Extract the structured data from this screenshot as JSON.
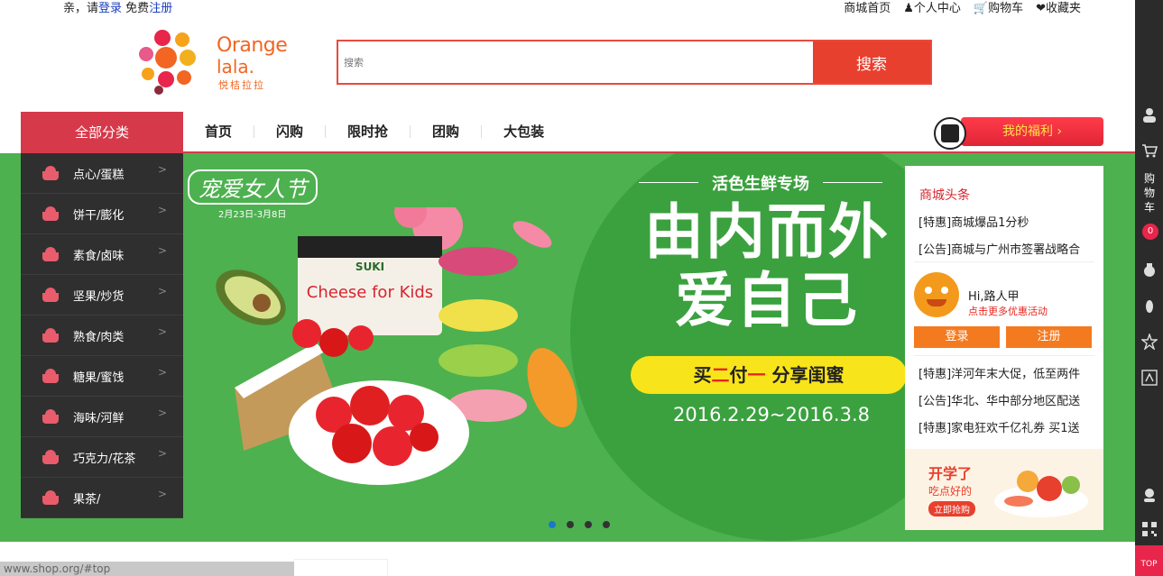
{
  "topbar": {
    "greet_prefix": "亲，请",
    "login_link": "登录",
    "register_prefix": "免费",
    "register_link": "注册",
    "links": [
      {
        "label": "商城首页",
        "icon": "home-link"
      },
      {
        "label": "个人中心",
        "icon": "user-icon"
      },
      {
        "label": "购物车",
        "icon": "cart-icon"
      },
      {
        "label": "收藏夹",
        "icon": "heart-icon"
      }
    ]
  },
  "logo": {
    "line1": "Orange",
    "line2": "lala.",
    "line3": "悦桔拉拉"
  },
  "search": {
    "placeholder": "搜索",
    "button": "搜索"
  },
  "nav": {
    "all_categories": "全部分类",
    "items": [
      "首页",
      "闪购",
      "限时抢",
      "团购",
      "大包装"
    ],
    "welfare": "我的福利 ›"
  },
  "categories": [
    {
      "label": "点心/蛋糕",
      "arrow": ">"
    },
    {
      "label": "饼干/膨化",
      "arrow": ">"
    },
    {
      "label": "素食/卤味",
      "arrow": ">"
    },
    {
      "label": "坚果/炒货",
      "arrow": ">"
    },
    {
      "label": "熟食/肉类",
      "arrow": ">"
    },
    {
      "label": "糖果/蜜饯",
      "arrow": ">"
    },
    {
      "label": "海味/河鲜",
      "arrow": ">"
    },
    {
      "label": "巧克力/花茶",
      "arrow": ">"
    },
    {
      "label": "果茶/",
      "arrow": ">"
    }
  ],
  "banner": {
    "event_title": "宠爱女人节",
    "event_dates": "2月23日-3月8日",
    "fresh_label": "活色生鲜专场",
    "headline_line1": "由内而外",
    "headline_line2": "爱自己",
    "promo_part1": "买",
    "promo_part2": "二",
    "promo_part3": "付",
    "promo_part4": "一",
    "promo_part5": " 分享闺蜜",
    "dates": "2016.2.29~2016.3.8",
    "package_brand": "SUKI",
    "package_text": "Cheese for Kids",
    "colors": {
      "background": "#4db14f",
      "circle": "#3aa13e",
      "promo": "#f8e41a"
    }
  },
  "carousel": {
    "dot_count": 4,
    "active_index": 0
  },
  "news": {
    "title": "商城头条",
    "top_items": [
      "[特惠]商城爆品1分秒",
      "[公告]商城与广州市签署战略合"
    ],
    "greeting": "Hi,路人甲",
    "more_link": "点击更多优惠活动",
    "login": "登录",
    "register": "注册",
    "bottom_items": [
      "[特惠]洋河年末大促，低至两件",
      "[公告]华北、华中部分地区配送",
      "[特惠]家电狂欢千亿礼券 买1送"
    ],
    "ad_title": "开学了",
    "ad_sub": "吃点好的",
    "ad_button": "立即抢购"
  },
  "sidebar_right": {
    "cart_label": "购物车",
    "cart_count": "0",
    "top_label": "TOP",
    "icons": [
      "user-icon",
      "cart-icon",
      "money-bag-icon",
      "footprint-icon",
      "star-icon",
      "recharge-icon",
      "service-icon",
      "qrcode-icon"
    ]
  },
  "statusbar": {
    "url": "www.shop.org/#top"
  }
}
